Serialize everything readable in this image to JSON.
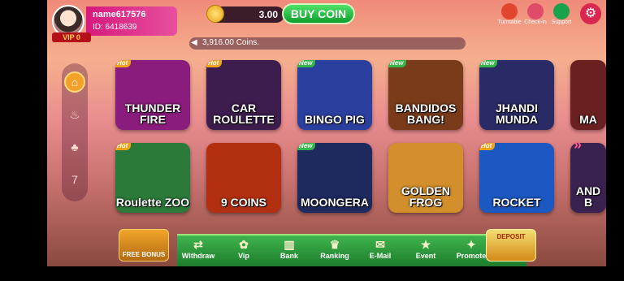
{
  "user": {
    "name": "name617576",
    "id_label": "ID: 6418639",
    "vip_label": "VIP 0"
  },
  "wallet": {
    "coins": "3.00",
    "buy_label": "BUY COIN"
  },
  "top_icons": [
    {
      "label": "Turntable",
      "icon": "turntable-icon",
      "color": "#e2452e"
    },
    {
      "label": "Check-in",
      "icon": "calendar-icon",
      "color": "#e04b6a"
    },
    {
      "label": "Support",
      "icon": "headset-icon",
      "color": "#1aa24b"
    }
  ],
  "marquee": {
    "text": "3,916.00 Coins."
  },
  "sidebar": [
    {
      "icon": "home-icon",
      "glyph": "⌂"
    },
    {
      "icon": "fire-icon",
      "glyph": "🔥"
    },
    {
      "icon": "cards-icon",
      "glyph": "♣"
    },
    {
      "icon": "slots-777-icon",
      "glyph": "7"
    }
  ],
  "games": [
    {
      "title": "THUNDER FIRE",
      "badge": "Hot",
      "bg": "#8a1c7d"
    },
    {
      "title": "CAR ROULETTE",
      "badge": "Hot",
      "bg": "#3d1d4d"
    },
    {
      "title": "BINGO PIG",
      "badge": "New",
      "bg": "#2b3f9e"
    },
    {
      "title": "BANDIDOS BANG!",
      "badge": "New",
      "bg": "#7a3b1a"
    },
    {
      "title": "JHANDI MUNDA",
      "badge": "New",
      "bg": "#2a2a66"
    },
    {
      "title": "MA",
      "badge": "",
      "bg": "#6a2020"
    },
    {
      "title": "Roulette ZOO",
      "badge": "Hot",
      "bg": "#2b7a3a"
    },
    {
      "title": "9 COINS",
      "badge": "",
      "bg": "#b23010"
    },
    {
      "title": "MOONGERA",
      "badge": "New",
      "bg": "#1e2a5e"
    },
    {
      "title": "GOLDEN FROG",
      "badge": "",
      "bg": "#d28f2b"
    },
    {
      "title": "ROCKET",
      "badge": "Hot",
      "bg": "#1c58c2"
    },
    {
      "title": "AND B",
      "badge": "",
      "bg": "#3a2250"
    }
  ],
  "free_bonus": {
    "label": "FREE BONUS"
  },
  "deposit": {
    "label": "DEPOSIT"
  },
  "bottom_nav": [
    {
      "label": "Withdraw",
      "icon": "withdraw-icon",
      "glyph": "⇄"
    },
    {
      "label": "Vip",
      "icon": "vip-icon",
      "glyph": "✿"
    },
    {
      "label": "Bank",
      "icon": "bank-icon",
      "glyph": "🏛"
    },
    {
      "label": "Ranking",
      "icon": "ranking-icon",
      "glyph": "♛"
    },
    {
      "label": "E-Mail",
      "icon": "mail-icon",
      "glyph": "✉"
    },
    {
      "label": "Event",
      "icon": "event-icon",
      "glyph": "★"
    },
    {
      "label": "Promote",
      "icon": "promote-icon",
      "glyph": "✦"
    }
  ]
}
